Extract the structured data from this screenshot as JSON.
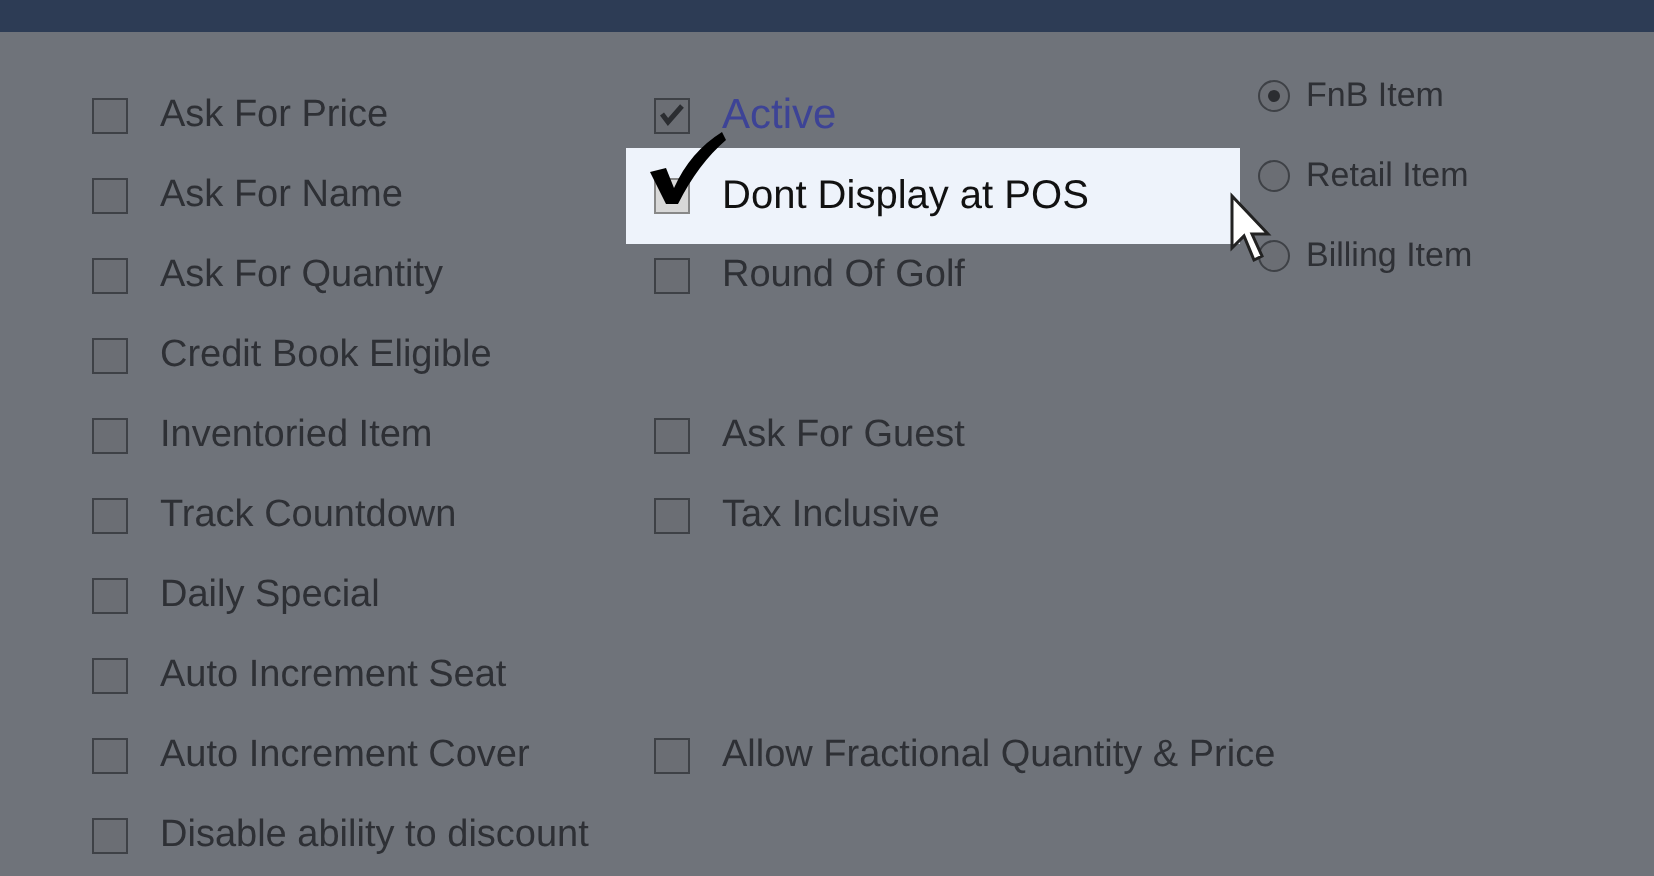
{
  "left_options": [
    {
      "label": "Ask For Price",
      "checked": false
    },
    {
      "label": "Ask For Name",
      "checked": false
    },
    {
      "label": "Ask For Quantity",
      "checked": false
    },
    {
      "label": "Credit Book Eligible",
      "checked": false
    },
    {
      "label": "Inventoried Item",
      "checked": false
    },
    {
      "label": "Track Countdown",
      "checked": false
    },
    {
      "label": "Daily Special",
      "checked": false
    },
    {
      "label": "Auto Increment Seat",
      "checked": false
    },
    {
      "label": "Auto Increment Cover",
      "checked": false
    },
    {
      "label": "Disable ability to discount",
      "checked": false
    }
  ],
  "middle_groups": [
    [
      {
        "label": "Active",
        "checked": true,
        "focused": true,
        "highlighted": false
      },
      {
        "label": "Dont Display at POS",
        "checked": true,
        "focused": false,
        "highlighted": true
      },
      {
        "label": "Round Of Golf",
        "checked": false,
        "focused": false,
        "highlighted": false
      }
    ],
    [
      {
        "label": "Ask For Guest",
        "checked": false,
        "focused": false,
        "highlighted": false
      },
      {
        "label": "Tax Inclusive",
        "checked": false,
        "focused": false,
        "highlighted": false
      }
    ],
    [
      {
        "label": "Allow Fractional Quantity & Price",
        "checked": false,
        "focused": false,
        "highlighted": false
      }
    ]
  ],
  "item_type": [
    {
      "label": "FnB Item",
      "selected": true
    },
    {
      "label": "Retail Item",
      "selected": false
    },
    {
      "label": "Billing Item",
      "selected": false
    }
  ]
}
